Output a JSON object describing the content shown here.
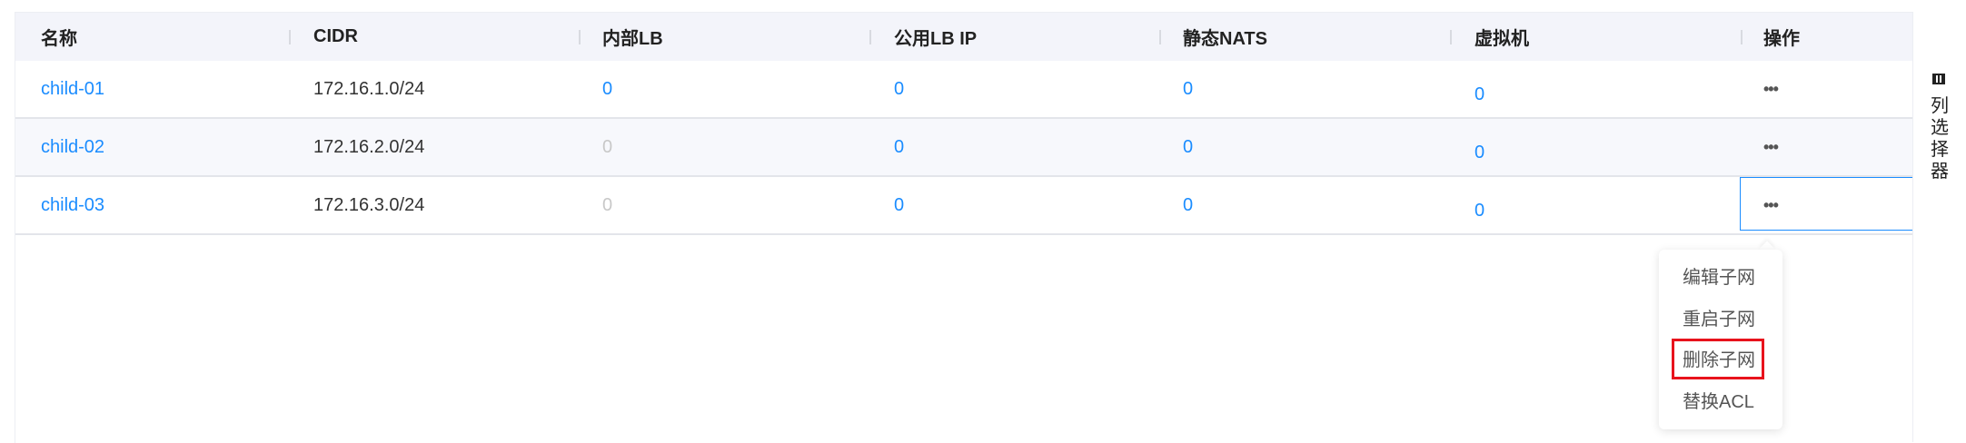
{
  "table": {
    "columns": [
      "名称",
      "CIDR",
      "内部LB",
      "公用LB IP",
      "静态NATS",
      "虚拟机",
      "操作"
    ],
    "rows": [
      {
        "name": "child-01",
        "cidr": "172.16.1.0/24",
        "internal_lb": "0",
        "public_lb_ip": "0",
        "static_nats": "0",
        "vms": "0",
        "actions": "•••"
      },
      {
        "name": "child-02",
        "cidr": "172.16.2.0/24",
        "internal_lb": "0",
        "public_lb_ip": "0",
        "static_nats": "0",
        "vms": "0",
        "actions": "•••"
      },
      {
        "name": "child-03",
        "cidr": "172.16.3.0/24",
        "internal_lb": "0",
        "public_lb_ip": "0",
        "static_nats": "0",
        "vms": "0",
        "actions": "•••"
      }
    ]
  },
  "column_selector": {
    "label": "列选择器",
    "icon": "columns-icon"
  },
  "action_menu": {
    "items": [
      "编辑子网",
      "重启子网",
      "删除子网",
      "替换ACL"
    ],
    "highlighted": "删除子网"
  },
  "colors": {
    "link": "#1a8cff",
    "highlight": "#e8131c",
    "header_bg": "#f3f4fa"
  }
}
